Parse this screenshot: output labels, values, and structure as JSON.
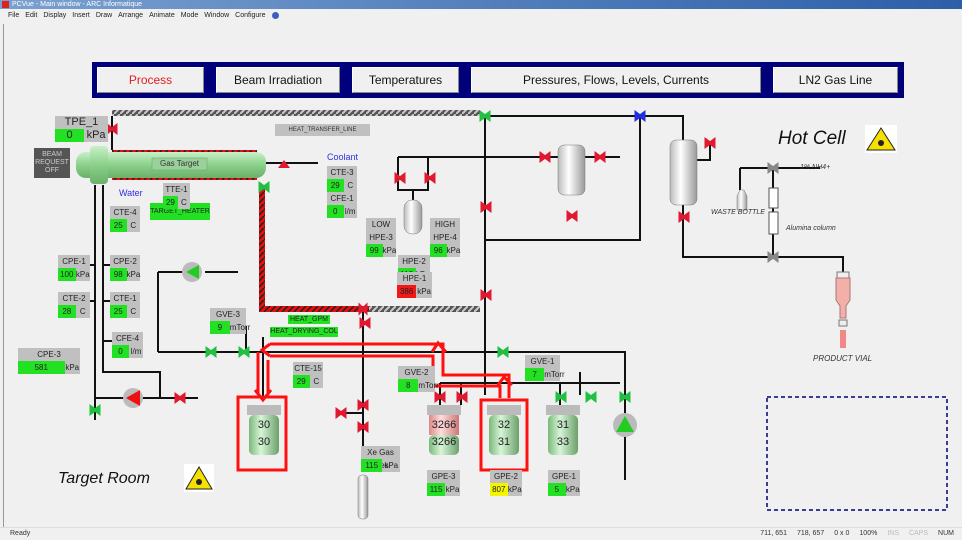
{
  "window": {
    "title": "PCVue - Main window - ARC Informatique"
  },
  "menu": [
    "File",
    "Edit",
    "Display",
    "Insert",
    "Draw",
    "Arrange",
    "Animate",
    "Mode",
    "Window",
    "Configure"
  ],
  "nav": {
    "process": "Process",
    "beam": "Beam Irradiation",
    "temps": "Temperatures",
    "pressures": "Pressures, Flows, Levels, Currents",
    "ln2": "LN2 Gas Line",
    "active": "Process"
  },
  "labels": {
    "gas_target": "Gas Target",
    "beam_request": "BEAM REQUEST OFF",
    "heat_transfer_line": "HEAT_TRANSFER_LINE",
    "coolant": "Coolant",
    "water": "Water",
    "target_heater": "TARGET_HEATER",
    "heat_gpm": "HEAT_GPM",
    "heat_drying_col": "HEAT_DRYING_COL",
    "hot_cell": "Hot Cell",
    "target_room": "Target Room",
    "nh4": "1% NH4+",
    "waste_bottle": "WASTE BOTTLE",
    "alumina_column": "Alumina column",
    "product_vial": "PRODUCT VIAL",
    "low": "LOW",
    "high": "HIGH"
  },
  "tags": {
    "tpe1": {
      "name": "TPE_1",
      "value": "0",
      "unit": "kPa"
    },
    "cte3": {
      "name": "CTE-3",
      "value": "29",
      "unit": "C"
    },
    "cfe1": {
      "name": "CFE-1",
      "value": "0",
      "unit": "l/m"
    },
    "tte1": {
      "name": "TTE-1",
      "value": "29",
      "unit": "C"
    },
    "cte4": {
      "name": "CTE-4",
      "value": "25",
      "unit": "C"
    },
    "cpe1": {
      "name": "CPE-1",
      "value": "100",
      "unit": "kPa"
    },
    "cpe2": {
      "name": "CPE-2",
      "value": "98",
      "unit": "kPa"
    },
    "cte2": {
      "name": "CTE-2",
      "value": "28",
      "unit": "C"
    },
    "cte1": {
      "name": "CTE-1",
      "value": "25",
      "unit": "C"
    },
    "cfe4": {
      "name": "CFE-4",
      "value": "0",
      "unit": "l/m"
    },
    "cpe3": {
      "name": "CPE-3",
      "value": "581",
      "unit": "kPa"
    },
    "gve3": {
      "name": "GVE-3",
      "value": "9",
      "unit": "mTorr"
    },
    "cte15": {
      "name": "CTE-15",
      "value": "29",
      "unit": "C"
    },
    "hpe3": {
      "name": "HPE-3",
      "value": "99",
      "unit": "kPa"
    },
    "hpe4": {
      "name": "HPE-4",
      "value": "96",
      "unit": "kPa"
    },
    "hpe2": {
      "name": "HPE-2",
      "value": "113",
      "unit": "kPa"
    },
    "hpe1": {
      "name": "HPE-1",
      "value": "386",
      "unit": "kPa"
    },
    "gve2": {
      "name": "GVE-2",
      "value": "8",
      "unit": "mTorr"
    },
    "gve1": {
      "name": "GVE-1",
      "value": "7",
      "unit": "mTorr"
    },
    "xegas": {
      "name": "Xe Gas Pres",
      "value": "115",
      "unit": "kPa"
    },
    "gpe3": {
      "name": "GPE-3",
      "value": "115",
      "unit": "kPa"
    },
    "gpe2": {
      "name": "GPE-2",
      "value": "807",
      "unit": "kPa"
    },
    "gpe1": {
      "name": "GPE-1",
      "value": "5",
      "unit": "kPa"
    }
  },
  "tanks": {
    "godm4": {
      "top": "30",
      "bottom": "30"
    },
    "godm3": {
      "top": "3266",
      "bottom": "3266"
    },
    "godm2": {
      "top": "32",
      "bottom": "31"
    },
    "godm1": {
      "top": "31",
      "bottom": "33"
    }
  },
  "colors": {
    "ok": "#22e022",
    "alarm": "#f01818",
    "warning": "#f5f500",
    "valve_closed": "#e01830",
    "valve_open": "#20c040",
    "nav_bg": "#00007a",
    "highlight": "#ff1010"
  },
  "status": {
    "ready": "Ready",
    "pos1": "711, 651",
    "pos2": "718, 657",
    "size": "0 x 0",
    "zoom": "100%",
    "ins": "INS",
    "caps": "CAPS",
    "num": "NUM"
  }
}
